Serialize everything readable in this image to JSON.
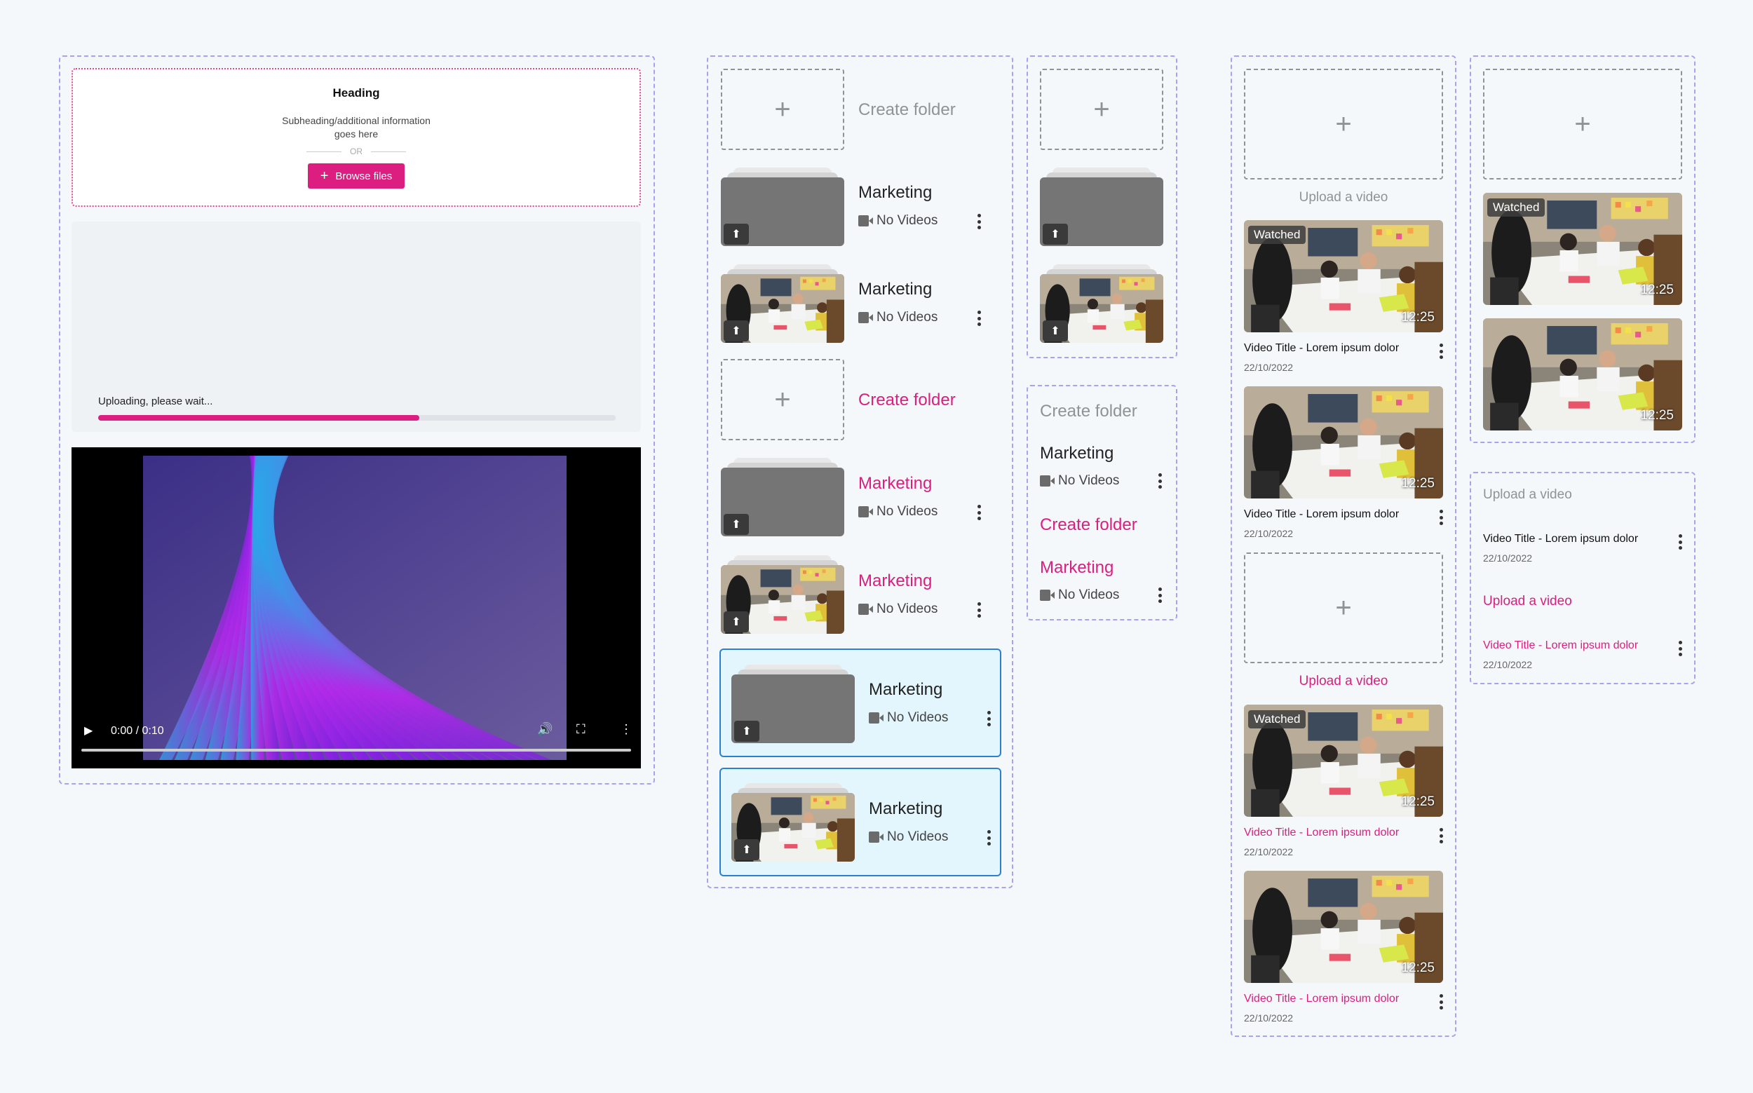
{
  "upload": {
    "heading": "Heading",
    "subheading": "Subheading/additional information goes here",
    "or": "OR",
    "browse": "Browse files",
    "status": "Uploading, please wait...",
    "progress": 0.62
  },
  "player": {
    "time": "0:00 / 0:10"
  },
  "folders": {
    "create_label": "Create folder",
    "title": "Marketing",
    "meta": "No Videos"
  },
  "videos": {
    "upload_label": "Upload a video",
    "watched": "Watched",
    "duration": "12:25",
    "title": "Video Title - Lorem ipsum dolor",
    "date": "22/10/2022"
  },
  "colors": {
    "accent": "#db1e80",
    "selected_border": "#2b7fd4",
    "selected_bg": "#e3f5fd"
  }
}
